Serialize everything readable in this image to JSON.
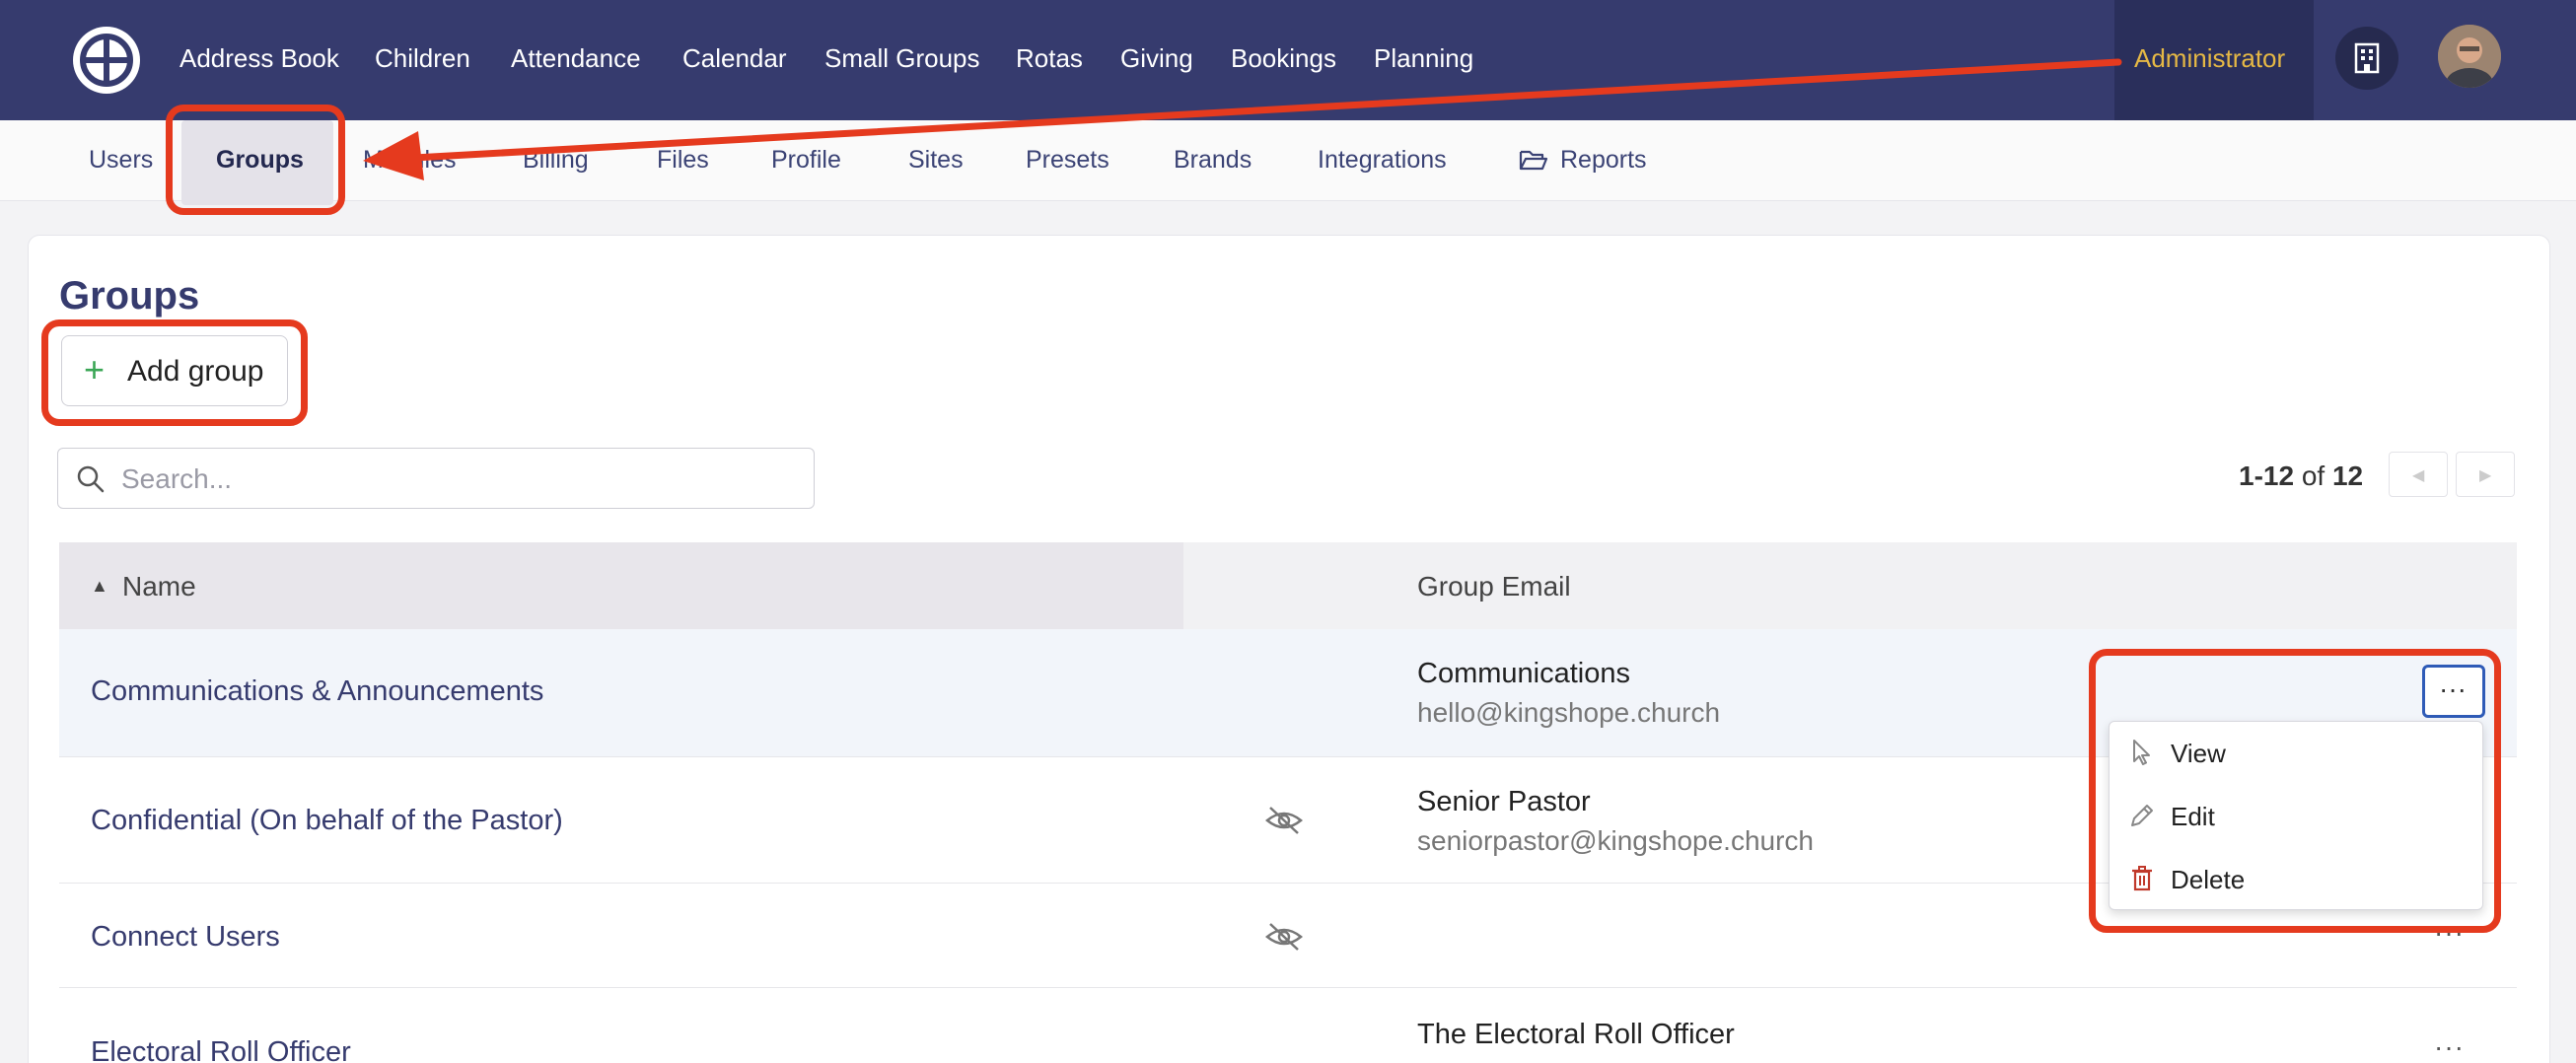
{
  "topnav": {
    "items": [
      "Address Book",
      "Children",
      "Attendance",
      "Calendar",
      "Small Groups",
      "Rotas",
      "Giving",
      "Bookings",
      "Planning"
    ],
    "admin_label": "Administrator"
  },
  "subnav": {
    "items": [
      "Users",
      "Groups",
      "Modules",
      "Billing",
      "Files",
      "Profile",
      "Sites",
      "Presets",
      "Brands",
      "Integrations",
      "Reports"
    ]
  },
  "page": {
    "title": "Groups",
    "add_button": "Add group",
    "search_placeholder": "Search...",
    "pager": {
      "range": "1-12",
      "of": "of",
      "total": "12"
    }
  },
  "table": {
    "headers": {
      "name": "Name",
      "email": "Group Email"
    },
    "rows": [
      {
        "name": "Communications & Announcements",
        "email_name": "Communications",
        "email_addr": "hello@kingshope.church",
        "hidden": false
      },
      {
        "name": "Confidential (On behalf of the Pastor)",
        "email_name": "Senior Pastor",
        "email_addr": "seniorpastor@kingshope.church",
        "hidden": true
      },
      {
        "name": "Connect Users",
        "email_name": "",
        "email_addr": "",
        "hidden": true
      },
      {
        "name": "Electoral Roll Officer",
        "email_name": "The Electoral Roll Officer",
        "email_addr": "",
        "hidden": false
      }
    ]
  },
  "row_menu": {
    "items": [
      {
        "label": "View",
        "icon": "pointer-icon"
      },
      {
        "label": "Edit",
        "icon": "pencil-icon"
      },
      {
        "label": "Delete",
        "icon": "trash-icon"
      }
    ]
  },
  "colors": {
    "brand": "#363b6e",
    "accent_admin": "#e5b845",
    "annotation": "#e53a1e",
    "delete": "#c0392b"
  }
}
